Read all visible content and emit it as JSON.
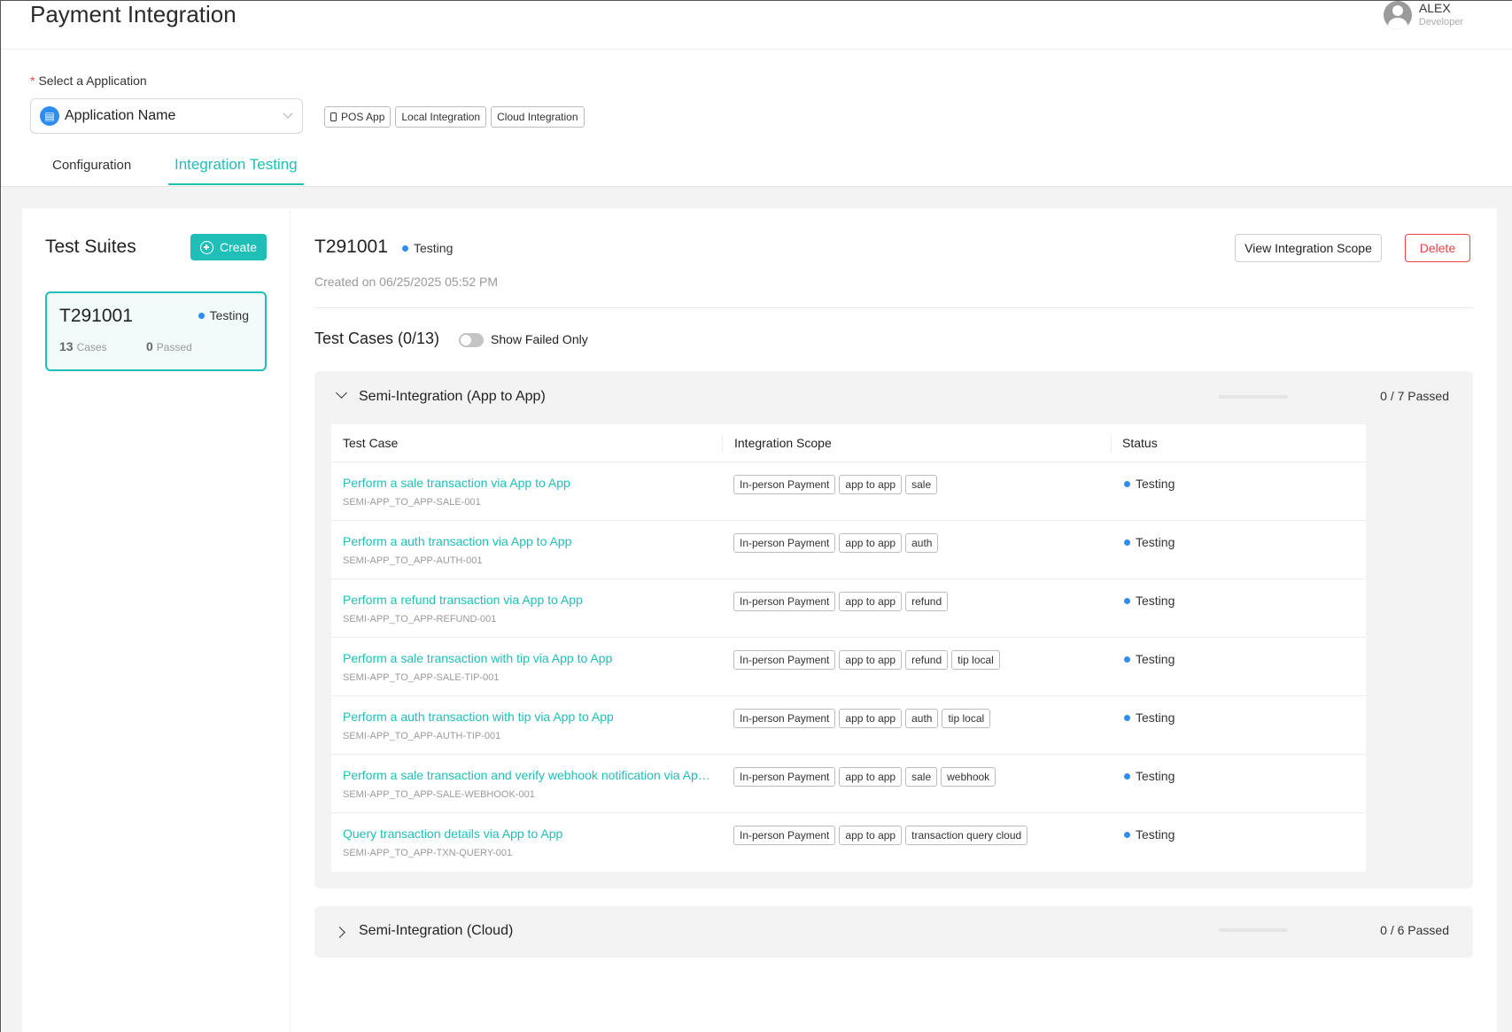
{
  "header": {
    "title": "Payment Integration",
    "user": {
      "name": "ALEX",
      "role": "Developer"
    }
  },
  "app_select": {
    "label": "Select a Application",
    "value": "Application Name",
    "tags": [
      "POS App",
      "Local Integration",
      "Cloud Integration"
    ]
  },
  "tabs": [
    {
      "label": "Configuration",
      "active": false
    },
    {
      "label": "Integration Testing",
      "active": true
    }
  ],
  "suites": {
    "title": "Test Suites",
    "create_label": "Create",
    "items": [
      {
        "id": "T291001",
        "status": "Testing",
        "cases_count": "13",
        "cases_label": "Cases",
        "passed_count": "0",
        "passed_label": "Passed"
      }
    ]
  },
  "detail": {
    "id": "T291001",
    "status": "Testing",
    "created": "Created on 06/25/2025  05:52 PM",
    "view_scope_label": "View Integration Scope",
    "delete_label": "Delete",
    "cases_title": "Test Cases (0/13)",
    "show_failed_label": "Show Failed Only",
    "show_failed_on": false
  },
  "groups": [
    {
      "title": "Semi-Integration (App to App)",
      "expanded": true,
      "progress_text": "0 / 7 Passed",
      "progress_fraction": 0,
      "columns": [
        "Test Case",
        "Integration Scope",
        "Status"
      ],
      "rows": [
        {
          "name": "Perform a sale transaction via App to App",
          "code": "SEMI-APP_TO_APP-SALE-001",
          "scope": [
            "In-person Payment",
            "app to app",
            "sale"
          ],
          "status": "Testing"
        },
        {
          "name": "Perform a auth transaction via App to App",
          "code": "SEMI-APP_TO_APP-AUTH-001",
          "scope": [
            "In-person Payment",
            "app to app",
            "auth"
          ],
          "status": "Testing"
        },
        {
          "name": "Perform a refund transaction via App to App",
          "code": "SEMI-APP_TO_APP-REFUND-001",
          "scope": [
            "In-person Payment",
            "app to app",
            "refund"
          ],
          "status": "Testing"
        },
        {
          "name": "Perform a sale transaction with tip via App to App",
          "code": "SEMI-APP_TO_APP-SALE-TIP-001",
          "scope": [
            "In-person Payment",
            "app to app",
            "refund",
            "tip local"
          ],
          "status": "Testing"
        },
        {
          "name": "Perform a auth transaction with tip via App to App",
          "code": "SEMI-APP_TO_APP-AUTH-TIP-001",
          "scope": [
            "In-person Payment",
            "app to app",
            "auth",
            "tip local"
          ],
          "status": "Testing"
        },
        {
          "name": "Perform a sale transaction and verify webhook notification via App to...",
          "code": "SEMI-APP_TO_APP-SALE-WEBHOOK-001",
          "scope": [
            "In-person Payment",
            "app to app",
            "sale",
            "webhook"
          ],
          "status": "Testing"
        },
        {
          "name": "Query transaction details via App to App",
          "code": "SEMI-APP_TO_APP-TXN-QUERY-001",
          "scope": [
            "In-person Payment",
            "app to app",
            "transaction query cloud"
          ],
          "status": "Testing"
        }
      ]
    },
    {
      "title": "Semi-Integration (Cloud)",
      "expanded": false,
      "progress_text": "0 / 6 Passed",
      "progress_fraction": 0
    }
  ],
  "colors": {
    "accent": "#1fbfb8",
    "status_dot": "#2f8cf0",
    "danger": "#e54545",
    "required": "#e54545"
  }
}
